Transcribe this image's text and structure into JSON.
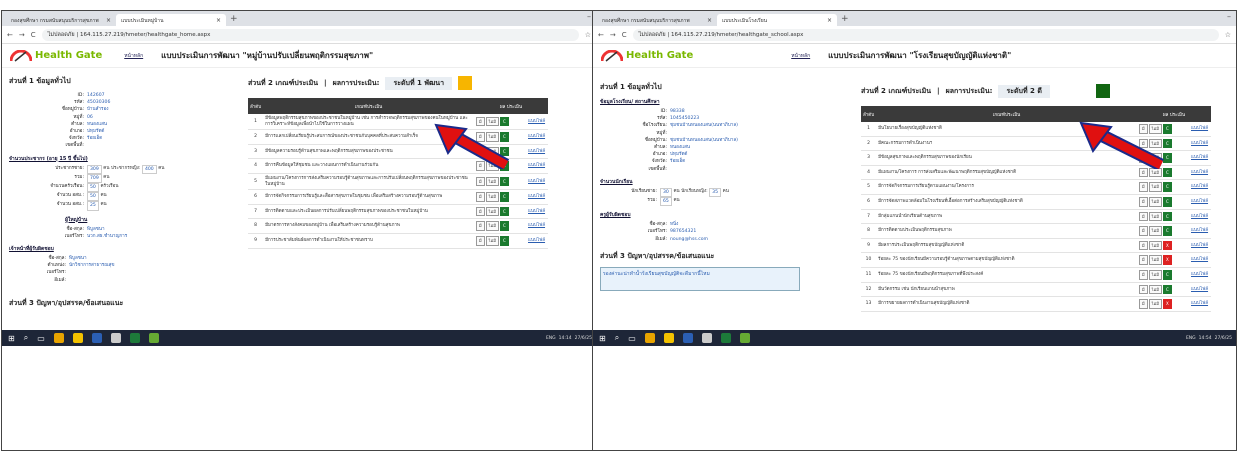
{
  "left": {
    "tabs": [
      {
        "title": "กองสุขศึกษา กรมสนับสนุนบริการสุขภาพ"
      },
      {
        "title": "แบบประเมินหมู่บ้าน"
      }
    ],
    "url": "ไม่ปลอดภัย | 164.115.27.219/hmeter/healthgate_home.aspx",
    "logo_text": "Health Gate",
    "nav_home": "หน้าหลัก",
    "page_title": "แบบประเมินการพัฒนา \"หมู่บ้านปรับเปลี่ยนพฤติกรรมสุขภาพ\"",
    "section1_title": "ส่วนที่ 1 ข้อมูลทั่วไป",
    "info": [
      {
        "k": "ID:",
        "v": "142607"
      },
      {
        "k": "รหัส:",
        "v": "45030306"
      },
      {
        "k": "ชื่อหมู่บ้าน:",
        "v": "บ้านสำรอง"
      },
      {
        "k": "หมู่ที่:",
        "v": "06"
      },
      {
        "k": "ตำบล:",
        "v": "หนองแสน"
      },
      {
        "k": "อำเภอ:",
        "v": "ปทุมรัตต์"
      },
      {
        "k": "จังหวัด:",
        "v": "ร้อยเอ็ด"
      },
      {
        "k": "เขตพื้นที่:",
        "v": ""
      }
    ],
    "pop_heading": "จำนวนประชากร (อายุ 15 ปี ขึ้นไป)",
    "pop": {
      "male_label": "ประชากรชาย:",
      "male": "309",
      "female_label": "ประชากรหญิง:",
      "female": "400",
      "unit": "คน",
      "total_label": "รวม:",
      "total": "709",
      "vol_label": "จำนวนครัวเรือน:",
      "vol": "50",
      "vol_unit": "ครัวเรือน",
      "osm_label": "จำนวน อสม.:",
      "osm": "50",
      "osm2_label": "จำนวน อสม.:",
      "osm2": "25"
    },
    "leader_heading": "ผู้ใหญ่บ้าน",
    "leader": [
      {
        "k": "ชื่อ-สกุล:",
        "v": "พิบูลชนา"
      },
      {
        "k": "เบอร์โทร:",
        "v": "นวก.สธ.ชำนาญการ"
      }
    ],
    "staff_heading": "เจ้าหน้าที่ผู้รับผิดชอบ",
    "staff": [
      {
        "k": "ชื่อ-สกุล:",
        "v": "พิบูลชนา"
      },
      {
        "k": "ตำแหน่ง:",
        "v": "นักวิชาการสาธารณสุข"
      },
      {
        "k": "เบอร์โทร:",
        "v": ""
      },
      {
        "k": "อีเมล์:",
        "v": ""
      }
    ],
    "section3_title": "ส่วนที่ 3 ปัญหา/อุปสรรค/ข้อเสนอแนะ",
    "section2_title": "ส่วนที่ 2 เกณฑ์ประเมิน",
    "result_label": "ผลการประเมิน:",
    "result_level": "ระดับที่ 1 พัฒนา",
    "result_color": "#f7b500",
    "table_headers": {
      "no": "ลำดับ",
      "criteria": "เกณฑ์ประเมิน",
      "score": "ผล ประเมิน"
    },
    "rows": [
      {
        "n": "1",
        "t": "มีข้อมูลพฤติกรรมสุขภาพของประชาชนในหมู่บ้าน เช่น การสำรวจพฤติกรรมสุขภาพของคนในหมู่บ้าน และการวิเคราะห์ข้อมูลเพื่อนำไปใช้ในการวางแผน",
        "yes": "มี",
        "no": "ไม่มี",
        "s": "C",
        "link": "แนบไฟล์"
      },
      {
        "n": "2",
        "t": "มีการแลกเปลี่ยนเรียนรู้ประสบการณ์ของประชาชนกับบุคคลที่ประสบความสำเร็จ",
        "yes": "มี",
        "no": "ไม่มี",
        "s": "C",
        "link": "แนบไฟล์"
      },
      {
        "n": "3",
        "t": "มีข้อมูลความรอบรู้ด้านสุขภาพและพฤติกรรมสุขภาพของประชาชน",
        "yes": "มี",
        "no": "ไม่มี",
        "s": "C",
        "link": "แนบไฟล์"
      },
      {
        "n": "4",
        "t": "มีการคืนข้อมูลให้ชุมชน และวางแผนการดำเนินงานร่วมกัน",
        "yes": "มี",
        "no": "ไม่มี",
        "s": "C",
        "link": "แนบไฟล์"
      },
      {
        "n": "5",
        "t": "มีแผนงาน/โครงการการส่งเสริมความรอบรู้ด้านสุขภาพและการปรับเปลี่ยนพฤติกรรมสุขภาพของประชาชนในหมู่บ้าน",
        "yes": "มี",
        "no": "ไม่มี",
        "s": "C",
        "link": "แนบไฟล์"
      },
      {
        "n": "6",
        "t": "มีการจัดกิจกรรมการเรียนรู้และสื่อสารสุขภาพในชุมชน เพื่อเสริมสร้างความรอบรู้ด้านสุขภาพ",
        "yes": "มี",
        "no": "ไม่มี",
        "s": "C",
        "link": "แนบไฟล์"
      },
      {
        "n": "7",
        "t": "มีการติดตามและประเมินผลการปรับเปลี่ยนพฤติกรรมสุขภาพของประชาชนในหมู่บ้าน",
        "yes": "มี",
        "no": "ไม่มี",
        "s": "C",
        "link": "แนบไฟล์"
      },
      {
        "n": "8",
        "t": "มีมาตรการทางสังคมของหมู่บ้าน เพื่อเสริมสร้างความรอบรู้ด้านสุขภาพ",
        "yes": "มี",
        "no": "ไม่มี",
        "s": "C",
        "link": "แนบไฟล์"
      },
      {
        "n": "9",
        "t": "มีการประชาสัมพันธ์ผลการดำเนินงานให้ประชาชนทราบ",
        "yes": "มี",
        "no": "ไม่มี",
        "s": "C",
        "link": "แนบไฟล์"
      }
    ]
  },
  "right": {
    "tabs": [
      {
        "title": "กองสุขศึกษา กรมสนับสนุนบริการสุขภาพ"
      },
      {
        "title": "แบบประเมินโรงเรียน"
      }
    ],
    "url": "ไม่ปลอดภัย | 164.115.27.219/hmeter/healthgate_school.aspx",
    "logo_text": "Health Gate",
    "nav_home": "หน้าหลัก",
    "page_title": "แบบประเมินการพัฒนา \"โรงเรียนสุขบัญญัติแห่งชาติ\"",
    "section1_title": "ส่วนที่ 1 ข้อมูลทั่วไป",
    "school_heading": "ข้อมูลโรงเรียน/ สถานศึกษา",
    "info": [
      {
        "k": "ID:",
        "v": "98338"
      },
      {
        "k": "รหัส:",
        "v": "1045450223"
      },
      {
        "k": "ชื่อโรงเรียน:",
        "v": "ชุมชนบ้านหนองแสน(นนทาภิบาล)"
      },
      {
        "k": "หมู่ที่:",
        "v": ""
      },
      {
        "k": "ชื่อหมู่บ้าน:",
        "v": "ชุมชนบ้านหนองแสน(นนทาภิบาล)"
      },
      {
        "k": "ตำบล:",
        "v": "หนองแสน"
      },
      {
        "k": "อำเภอ:",
        "v": "ปทุมรัตต์"
      },
      {
        "k": "จังหวัด:",
        "v": "ร้อยเอ็ด"
      },
      {
        "k": "เขตพื้นที่:",
        "v": ""
      }
    ],
    "student_heading": "จำนวนนักเรียน",
    "students": {
      "male_label": "นักเรียนชาย:",
      "male": "30",
      "female_label": "นักเรียนหญิง:",
      "female": "35",
      "unit": "คน",
      "total_label": "รวม:",
      "total": "65"
    },
    "staff_heading": "ครูผู้รับผิดชอบ",
    "staff": [
      {
        "k": "ชื่อ-สกุล:",
        "v": "หนิ่ง"
      },
      {
        "k": "เบอร์โทร:",
        "v": "987654321"
      },
      {
        "k": "อีเมล์:",
        "v": "noung@hss.com"
      }
    ],
    "section3_title": "ส่วนที่ 3 ปัญหา/อุปสรรค/ข้อเสนอแนะ",
    "section3_text": "รองค่านะน่าทำน้ำร้งเรียนสุขบัญญัติจะดีมากนี้ไหม",
    "section2_title": "ส่วนที่ 2 เกณฑ์ประเมิน",
    "result_label": "ผลการประเมิน:",
    "result_level": "ระดับที่ 2 ดี",
    "result_color": "#116611",
    "table_headers": {
      "no": "ลำดับ",
      "criteria": "เกณฑ์ประเมิน",
      "score": "ผล ประเมิน"
    },
    "rows": [
      {
        "n": "1",
        "t": "มีนโยบายเรื่องสุขบัญญัติแห่งชาติ",
        "yes": "มี",
        "no": "ไม่มี",
        "s": "C",
        "link": "แนบไฟล์"
      },
      {
        "n": "2",
        "t": "มีคณะกรรมการดำเนินงานฯ",
        "yes": "มี",
        "no": "ไม่มี",
        "s": "C",
        "link": "แนบไฟล์"
      },
      {
        "n": "3",
        "t": "มีข้อมูลสุขภาพและพฤติกรรมสุขภาพของนักเรียน",
        "yes": "มี",
        "no": "ไม่มี",
        "s": "C",
        "link": "แนบไฟล์"
      },
      {
        "n": "4",
        "t": "มีแผนงาน/โครงการ การส่งเสริมและพัฒนาพฤติกรรมสุขบัญญัติแห่งชาติ",
        "yes": "มี",
        "no": "ไม่มี",
        "s": "C",
        "link": "แนบไฟล์"
      },
      {
        "n": "5",
        "t": "มีการจัดกิจกรรมการเรียนรู้ตามแผนงาน/โครงการ",
        "yes": "มี",
        "no": "ไม่มี",
        "s": "C",
        "link": "แนบไฟล์"
      },
      {
        "n": "6",
        "t": "มีการจัดสภาพแวดล้อมในโรงเรียนที่เอื้อต่อการสร้างเสริมสุขบัญญัติแห่งชาติ",
        "yes": "มี",
        "no": "ไม่มี",
        "s": "C",
        "link": "แนบไฟล์"
      },
      {
        "n": "7",
        "t": "มีกลุ่มแกนนำนักเรียนด้านสุขภาพ",
        "yes": "มี",
        "no": "ไม่มี",
        "s": "C",
        "link": "แนบไฟล์"
      },
      {
        "n": "8",
        "t": "มีการติดตามประเมินพฤติกรรมสุขภาพ",
        "yes": "มี",
        "no": "ไม่มี",
        "s": "C",
        "link": "แนบไฟล์"
      },
      {
        "n": "9",
        "t": "มีผลการประเมินพฤติกรรมสุขบัญญัติแห่งชาติ",
        "yes": "มี",
        "no": "ไม่มี",
        "s": "X",
        "link": "แนบไฟล์"
      },
      {
        "n": "10",
        "t": "ร้อยละ 75 ของนักเรียนมีความรอบรู้ด้านสุขภาพตามสุขบัญญัติแห่งชาติ",
        "yes": "มี",
        "no": "ไม่มี",
        "s": "X",
        "link": "แนบไฟล์"
      },
      {
        "n": "11",
        "t": "ร้อยละ 75 ของนักเรียนมีพฤติกรรมสุขภาพที่พึงประสงค์",
        "yes": "มี",
        "no": "ไม่มี",
        "s": "C",
        "link": "แนบไฟล์"
      },
      {
        "n": "12",
        "t": "มีนวัตกรรม เช่น นักเรียนแกนนำสุขภาพ",
        "yes": "มี",
        "no": "ไม่มี",
        "s": "C",
        "link": "แนบไฟล์"
      },
      {
        "n": "13",
        "t": "มีการขยายผลการดำเนินงานสุขบัญญัติแห่งชาติ",
        "yes": "มี",
        "no": "ไม่มี",
        "s": "X",
        "link": "แนบไฟล์"
      }
    ]
  },
  "taskbar": {
    "lang": "ENG",
    "time_left": "14:14",
    "date_left": "27/6/25",
    "time_right": "14:54",
    "date_right": "27/6/25"
  }
}
